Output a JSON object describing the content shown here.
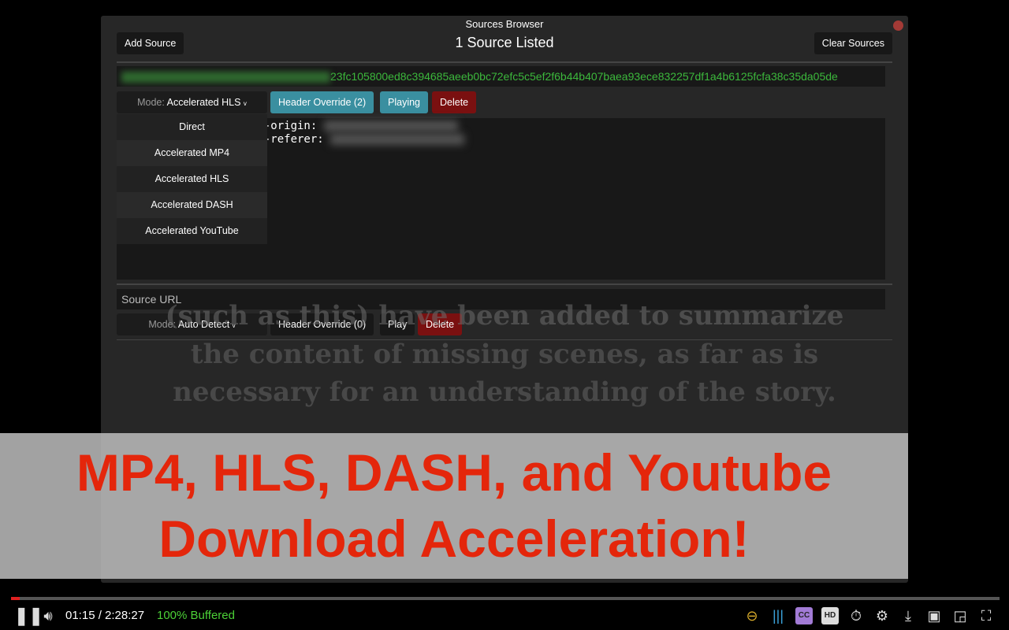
{
  "background_subtitle": [
    "(such as this) have been added to summarize",
    "the content of missing scenes, as far as is",
    "necessary for an understanding of the story."
  ],
  "window": {
    "title": "Sources Browser",
    "count": "1 Source Listed",
    "add_source": "Add Source",
    "clear_sources": "Clear Sources"
  },
  "source1": {
    "url_tail": "23fc105800ed8c394685aeeb0bc72efc5c5ef2f6b44b407baea93ece832257df1a4b6125fcfa38c35da05de",
    "mode_label": "Mode:",
    "mode_value": "Accelerated HLS",
    "header_override": "Header Override (2)",
    "play": "Playing",
    "delete": "Delete",
    "headers": [
      "er-origin:",
      "er-referer:"
    ],
    "mode_options": [
      "Direct",
      "Accelerated MP4",
      "Accelerated HLS",
      "Accelerated DASH",
      "Accelerated YouTube"
    ]
  },
  "new_source": {
    "placeholder": "Source URL",
    "mode_label": "Mode:",
    "mode_value": "Auto Detect",
    "header_override": "Header Override (0)",
    "play": "Play",
    "delete": "Delete"
  },
  "banner": [
    "MP4, HLS, DASH, and Youtube",
    "Download Acceleration!"
  ],
  "player": {
    "time": "01:15 / 2:28:27",
    "buffered": "100% Buffered",
    "progress_fraction": 0.0084,
    "colors": {
      "buffered": "#4cd137",
      "progress": "#e02020"
    }
  }
}
